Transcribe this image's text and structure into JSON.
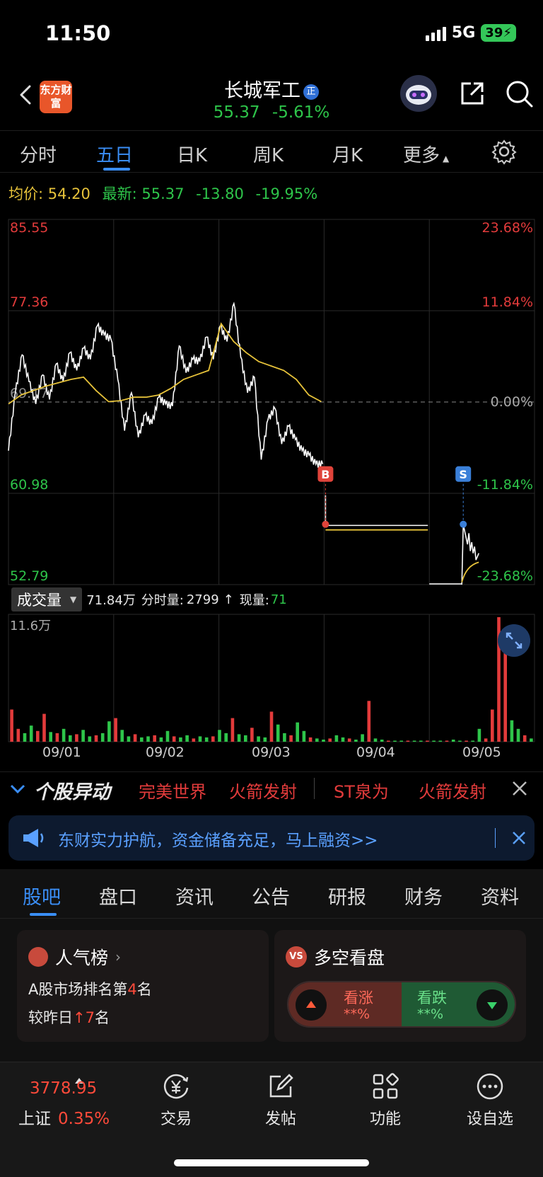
{
  "status_bar": {
    "time": "11:50",
    "network": "5G",
    "battery": "39"
  },
  "header": {
    "logo_text": "东方财富",
    "stock_name": "长城军工",
    "margin_badge": "正",
    "price": "55.37",
    "change_pct": "-5.61%"
  },
  "tabs": [
    {
      "label": "分时"
    },
    {
      "label": "五日"
    },
    {
      "label": "日K"
    },
    {
      "label": "周K"
    },
    {
      "label": "月K"
    },
    {
      "label": "更多"
    }
  ],
  "active_tab": "五日",
  "info": {
    "avg_label": "均价:",
    "avg_value": "54.20",
    "latest_label": "最新:",
    "latest_value": "55.37",
    "change": "-13.80",
    "change_pct": "-19.95%"
  },
  "chart_data": {
    "type": "line",
    "title": "",
    "x_dates": [
      "09/01",
      "09/02",
      "09/03",
      "09/04",
      "09/05"
    ],
    "y_left_ticks": [
      "85.55",
      "77.36",
      "69.17",
      "60.98",
      "52.79"
    ],
    "y_right_ticks": [
      "23.68%",
      "11.84%",
      "0.00%",
      "-11.84%",
      "-23.68%"
    ],
    "ylim": [
      52.79,
      85.55
    ],
    "prev_close": 69.17,
    "series": [
      {
        "name": "最新",
        "color": "#ffffff",
        "values": [
          64.8,
          70.0,
          73.4,
          71.0,
          69.0,
          71.6,
          69.4,
          72.6,
          71.0,
          73.6,
          72.0,
          74.0,
          73.0,
          76.0,
          75.2,
          74.8,
          71.2,
          66.6,
          70.0,
          66.0,
          68.0,
          67.2,
          69.6,
          69.0,
          68.8,
          74.2,
          71.8,
          73.0,
          72.8,
          75.0,
          73.0,
          76.0,
          74.6,
          78.0,
          73.2,
          70.0,
          71.4,
          64.0,
          67.6,
          68.6,
          65.4,
          67.0,
          65.8,
          64.8,
          64.4,
          63.6,
          63.6
        ],
        "note": "intraday path days 09/01-09/03 (approximate)"
      },
      {
        "name": "均价",
        "color": "#e6c23a",
        "values": [
          69.0,
          69.8,
          70.2,
          70.6,
          70.9,
          71.2,
          71.4,
          70.2,
          69.2,
          69.3,
          69.6,
          69.6,
          69.8,
          70.4,
          71.2,
          71.6,
          72.0,
          76.2,
          74.6,
          73.6,
          72.8,
          72.4,
          72.0,
          71.2,
          69.8,
          69.2
        ],
        "note": "average price path (approximate)"
      },
      {
        "name": "09/04-09/05",
        "color": "#ffffff",
        "values": [
          60.8,
          58.0,
          58.0,
          58.0,
          52.79,
          52.79,
          55.2,
          58.2,
          56.4,
          57.0,
          55.6,
          56.8
        ],
        "note": "limit-down days with B/S markers"
      }
    ],
    "markers": [
      {
        "label": "B",
        "date": "09/04",
        "price": 58.2,
        "color": "#e0433a"
      },
      {
        "label": "S",
        "date": "09/05",
        "price": 58.2,
        "color": "#3a7fd8"
      }
    ],
    "ylabel": "",
    "grid": true
  },
  "volume": {
    "selector": "成交量",
    "total": "71.84万",
    "minute_label": "分时量:",
    "minute_value": "2799",
    "arrow": "↑",
    "current_label": "现量:",
    "current_value": "71",
    "max_label": "11.6万",
    "values": [
      3,
      1.2,
      0.8,
      1.5,
      1,
      2.6,
      0.9,
      0.8,
      1.2,
      0.6,
      0.7,
      1.1,
      0.5,
      0.6,
      0.8,
      1.9,
      2.2,
      1.1,
      0.5,
      0.7,
      0.4,
      0.5,
      0.6,
      0.4,
      1.0,
      0.5,
      0.4,
      0.6,
      0.3,
      0.5,
      0.4,
      0.5,
      1.1,
      0.8,
      2.2,
      0.7,
      0.6,
      1.3,
      0.5,
      0.4,
      2.8,
      1.6,
      0.8,
      0.6,
      1.8,
      1.0,
      0.4,
      0.3,
      0.2,
      0.3,
      0.6,
      0.4,
      0.3,
      0.2,
      0.7,
      3.8,
      0.3,
      0.2,
      0.1,
      0.1,
      0.1,
      0.1,
      0.1,
      0.1,
      0.1,
      0.1,
      0.1,
      0.1,
      0.2,
      0.1,
      0.1,
      0.1,
      1.2,
      0.3,
      3.0,
      11.6,
      9.8,
      2.0,
      1.2,
      0.6,
      0.3
    ]
  },
  "dates": [
    "09/01",
    "09/02",
    "09/03",
    "09/04",
    "09/05"
  ],
  "movers": {
    "title": "个股异动",
    "items": [
      "完美世界",
      "火箭发射",
      "ST泉为",
      "火箭发射"
    ]
  },
  "banner": {
    "text": "东财实力护航，资金储备充足，马上融资>>"
  },
  "lower_tabs": [
    "股吧",
    "盘口",
    "资讯",
    "公告",
    "研报",
    "财务",
    "资料"
  ],
  "popularity": {
    "title": "人气榜",
    "line1_pre": "A股市场排名第",
    "rank": "4",
    "line1_post": "名",
    "line2_pre": "较昨日",
    "delta": "7",
    "line2_post": "名"
  },
  "sentiment": {
    "title": "多空看盘",
    "bull_label": "看涨",
    "bull_pct": "**%",
    "bear_label": "看跌",
    "bear_pct": "**%"
  },
  "bottom_nav": {
    "index_value": "3778.95",
    "index_name": "上证",
    "index_pct": "0.35%",
    "items": [
      {
        "label": "交易",
        "icon": "yen-coin-icon"
      },
      {
        "label": "发帖",
        "icon": "edit-icon"
      },
      {
        "label": "功能",
        "icon": "grid-apps-icon"
      },
      {
        "label": "设自选",
        "icon": "more-dots-icon"
      }
    ]
  },
  "colors": {
    "up": "#e23b3b",
    "down": "#2ec54a",
    "accent": "#3a8ef6",
    "avg_line": "#e6c23a"
  }
}
